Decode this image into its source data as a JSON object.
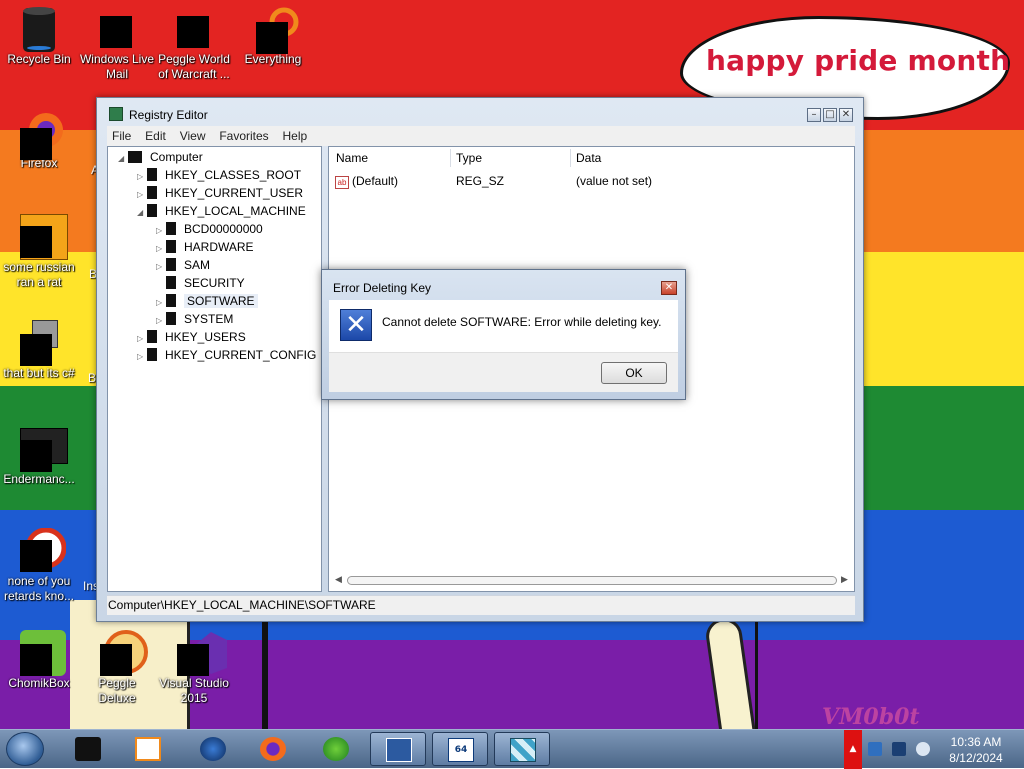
{
  "wallpaper": {
    "stripe_colors": [
      "#e32422",
      "#f47a1f",
      "#ffe42a",
      "#1e8a33",
      "#1d5bd2",
      "#7a1ea8"
    ],
    "speech_bubble": "happy pride month",
    "watermark": "VM0b0t"
  },
  "desktop_icons": [
    {
      "label": "Recycle Bin",
      "icon": "recycle-bin-icon"
    },
    {
      "label": "Windows Live Mail",
      "icon": "windows-live-mail-icon"
    },
    {
      "label": "Peggle World of Warcraft ...",
      "icon": "peggle-wow-icon"
    },
    {
      "label": "Everything",
      "icon": "everything-search-icon"
    },
    {
      "label": "Firefox",
      "icon": "firefox-icon"
    },
    {
      "label": "some russian ran a rat",
      "icon": "rat-app-icon"
    },
    {
      "label": "that but its c#",
      "icon": "csharp-app-icon"
    },
    {
      "label": "Endermanc...",
      "icon": "endermanch-folder-icon"
    },
    {
      "label": "none of you retards kno...",
      "icon": "generic-app-icon"
    },
    {
      "label": "ChomikBox",
      "icon": "chomikbox-icon"
    },
    {
      "label": "Peggle Deluxe",
      "icon": "peggle-deluxe-icon"
    },
    {
      "label": "Visual Studio 2015",
      "icon": "visual-studio-icon"
    }
  ],
  "partial_icon_labels": [
    "A",
    "B",
    "B",
    "Ins"
  ],
  "window": {
    "title": "Registry Editor",
    "menu": [
      "File",
      "Edit",
      "View",
      "Favorites",
      "Help"
    ],
    "tree": [
      {
        "label": "Computer",
        "level": 0,
        "expander": "◢"
      },
      {
        "label": "HKEY_CLASSES_ROOT",
        "level": 1,
        "expander": "▷"
      },
      {
        "label": "HKEY_CURRENT_USER",
        "level": 1,
        "expander": "▷"
      },
      {
        "label": "HKEY_LOCAL_MACHINE",
        "level": 1,
        "expander": "◢"
      },
      {
        "label": "BCD00000000",
        "level": 2,
        "expander": "▷"
      },
      {
        "label": "HARDWARE",
        "level": 2,
        "expander": "▷"
      },
      {
        "label": "SAM",
        "level": 2,
        "expander": "▷"
      },
      {
        "label": "SECURITY",
        "level": 2,
        "expander": ""
      },
      {
        "label": "SOFTWARE",
        "level": 2,
        "expander": "▷",
        "selected": true
      },
      {
        "label": "SYSTEM",
        "level": 2,
        "expander": "▷"
      },
      {
        "label": "HKEY_USERS",
        "level": 1,
        "expander": "▷"
      },
      {
        "label": "HKEY_CURRENT_CONFIG",
        "level": 1,
        "expander": "▷"
      }
    ],
    "columns": [
      "Name",
      "Type",
      "Data"
    ],
    "values": [
      {
        "name": "(Default)",
        "type": "REG_SZ",
        "data": "(value not set)"
      }
    ],
    "status_path": "Computer\\HKEY_LOCAL_MACHINE\\SOFTWARE"
  },
  "dialog": {
    "title": "Error Deleting Key",
    "message": "Cannot delete SOFTWARE:  Error while deleting key.",
    "ok_label": "OK"
  },
  "taskbar": {
    "pinned": [
      {
        "icon": "start-orb-icon"
      },
      {
        "icon": "computer-icon"
      },
      {
        "icon": "media-player-icon"
      },
      {
        "icon": "globe-icon"
      },
      {
        "icon": "firefox-icon"
      },
      {
        "icon": "download-manager-icon"
      },
      {
        "icon": "virtualbox-icon",
        "active": true
      },
      {
        "icon": "win7-64-icon",
        "active": true,
        "badge": "64"
      },
      {
        "icon": "registry-editor-icon",
        "active": true
      }
    ],
    "tray_icons": [
      "network-icon",
      "speaker-icon",
      "volume-icon"
    ],
    "clock_time": "10:36 AM",
    "clock_date": "8/12/2024"
  }
}
